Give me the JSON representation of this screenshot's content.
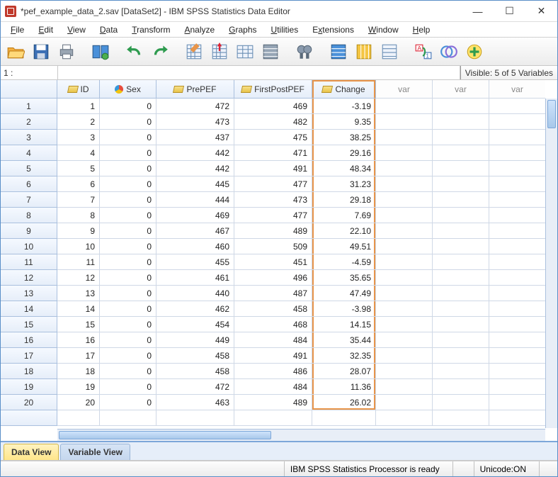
{
  "window": {
    "title": "*pef_example_data_2.sav [DataSet2] - IBM SPSS Statistics Data Editor"
  },
  "menu": [
    {
      "u": "F",
      "rest": "ile"
    },
    {
      "u": "E",
      "rest": "dit"
    },
    {
      "u": "V",
      "rest": "iew"
    },
    {
      "u": "D",
      "rest": "ata"
    },
    {
      "u": "T",
      "rest": "ransform"
    },
    {
      "u": "A",
      "rest": "nalyze"
    },
    {
      "u": "G",
      "rest": "raphs"
    },
    {
      "u": "U",
      "rest": "tilities"
    },
    {
      "u": "E",
      "pre": "E",
      "rest": "tensions",
      "full": "Extensions",
      "uidx": 1
    },
    {
      "u": "W",
      "rest": "indow"
    },
    {
      "u": "H",
      "rest": "elp"
    }
  ],
  "cell_indicator": {
    "label": "1 :",
    "visible_text": "Visible: 5 of 5 Variables"
  },
  "columns": [
    {
      "name": "ID",
      "type": "scale"
    },
    {
      "name": "Sex",
      "type": "nominal"
    },
    {
      "name": "PrePEF",
      "type": "scale"
    },
    {
      "name": "FirstPostPEF",
      "type": "scale"
    },
    {
      "name": "Change",
      "type": "scale",
      "highlight": true
    }
  ],
  "empty_headers": [
    "var",
    "var",
    "var"
  ],
  "rows": [
    {
      "n": 1,
      "ID": 1,
      "Sex": 0,
      "PrePEF": 472,
      "FirstPostPEF": 469,
      "Change": "-3.19"
    },
    {
      "n": 2,
      "ID": 2,
      "Sex": 0,
      "PrePEF": 473,
      "FirstPostPEF": 482,
      "Change": "9.35"
    },
    {
      "n": 3,
      "ID": 3,
      "Sex": 0,
      "PrePEF": 437,
      "FirstPostPEF": 475,
      "Change": "38.25"
    },
    {
      "n": 4,
      "ID": 4,
      "Sex": 0,
      "PrePEF": 442,
      "FirstPostPEF": 471,
      "Change": "29.16"
    },
    {
      "n": 5,
      "ID": 5,
      "Sex": 0,
      "PrePEF": 442,
      "FirstPostPEF": 491,
      "Change": "48.34"
    },
    {
      "n": 6,
      "ID": 6,
      "Sex": 0,
      "PrePEF": 445,
      "FirstPostPEF": 477,
      "Change": "31.23"
    },
    {
      "n": 7,
      "ID": 7,
      "Sex": 0,
      "PrePEF": 444,
      "FirstPostPEF": 473,
      "Change": "29.18"
    },
    {
      "n": 8,
      "ID": 8,
      "Sex": 0,
      "PrePEF": 469,
      "FirstPostPEF": 477,
      "Change": "7.69"
    },
    {
      "n": 9,
      "ID": 9,
      "Sex": 0,
      "PrePEF": 467,
      "FirstPostPEF": 489,
      "Change": "22.10"
    },
    {
      "n": 10,
      "ID": 10,
      "Sex": 0,
      "PrePEF": 460,
      "FirstPostPEF": 509,
      "Change": "49.51"
    },
    {
      "n": 11,
      "ID": 11,
      "Sex": 0,
      "PrePEF": 455,
      "FirstPostPEF": 451,
      "Change": "-4.59"
    },
    {
      "n": 12,
      "ID": 12,
      "Sex": 0,
      "PrePEF": 461,
      "FirstPostPEF": 496,
      "Change": "35.65"
    },
    {
      "n": 13,
      "ID": 13,
      "Sex": 0,
      "PrePEF": 440,
      "FirstPostPEF": 487,
      "Change": "47.49"
    },
    {
      "n": 14,
      "ID": 14,
      "Sex": 0,
      "PrePEF": 462,
      "FirstPostPEF": 458,
      "Change": "-3.98"
    },
    {
      "n": 15,
      "ID": 15,
      "Sex": 0,
      "PrePEF": 454,
      "FirstPostPEF": 468,
      "Change": "14.15"
    },
    {
      "n": 16,
      "ID": 16,
      "Sex": 0,
      "PrePEF": 449,
      "FirstPostPEF": 484,
      "Change": "35.44"
    },
    {
      "n": 17,
      "ID": 17,
      "Sex": 0,
      "PrePEF": 458,
      "FirstPostPEF": 491,
      "Change": "32.35"
    },
    {
      "n": 18,
      "ID": 18,
      "Sex": 0,
      "PrePEF": 458,
      "FirstPostPEF": 486,
      "Change": "28.07"
    },
    {
      "n": 19,
      "ID": 19,
      "Sex": 0,
      "PrePEF": 472,
      "FirstPostPEF": 484,
      "Change": "11.36"
    },
    {
      "n": 20,
      "ID": 20,
      "Sex": 0,
      "PrePEF": 463,
      "FirstPostPEF": 489,
      "Change": "26.02"
    }
  ],
  "tabs": {
    "data_view": "Data View",
    "variable_view": "Variable View"
  },
  "status": {
    "processor": "IBM SPSS Statistics Processor is ready",
    "unicode": "Unicode:ON"
  }
}
